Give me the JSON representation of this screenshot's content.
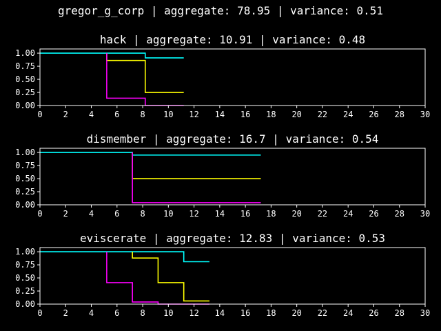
{
  "suptitle": "gregor_g_corp | aggregate: 78.95 | variance: 0.51",
  "chart_data": [
    {
      "type": "line",
      "title": "hack | aggregate: 10.91 | variance: 0.48",
      "xlim": [
        0,
        30
      ],
      "ylim": [
        0,
        1.08
      ],
      "xticks": [
        "0",
        "2",
        "4",
        "6",
        "8",
        "10",
        "12",
        "14",
        "16",
        "18",
        "20",
        "22",
        "24",
        "26",
        "28",
        "30"
      ],
      "yticks": [
        "0.00",
        "0.25",
        "0.50",
        "0.75",
        "1.00"
      ],
      "series": [
        {
          "color": "#00ffff",
          "x": [
            0,
            8.2,
            8.2,
            11.2
          ],
          "y": [
            1.0,
            1.0,
            0.91,
            0.91
          ]
        },
        {
          "color": "#ffff00",
          "x": [
            5.2,
            5.2,
            8.2,
            8.2,
            11.2
          ],
          "y": [
            1.0,
            0.86,
            0.86,
            0.25,
            0.25
          ]
        },
        {
          "color": "#ff00ff",
          "x": [
            5.2,
            5.2,
            8.2,
            8.2,
            11.2
          ],
          "y": [
            1.0,
            0.14,
            0.14,
            0.0,
            0.0
          ]
        }
      ]
    },
    {
      "type": "line",
      "title": "dismember | aggregate: 16.7 | variance: 0.54",
      "xlim": [
        0,
        30
      ],
      "ylim": [
        0,
        1.08
      ],
      "xticks": [
        "0",
        "2",
        "4",
        "6",
        "8",
        "10",
        "12",
        "14",
        "16",
        "18",
        "20",
        "22",
        "24",
        "26",
        "28",
        "30"
      ],
      "yticks": [
        "0.00",
        "0.25",
        "0.50",
        "0.75",
        "1.00"
      ],
      "series": [
        {
          "color": "#00ffff",
          "x": [
            0,
            7.2,
            7.2,
            17.2
          ],
          "y": [
            1.0,
            1.0,
            0.95,
            0.95
          ]
        },
        {
          "color": "#ffff00",
          "x": [
            7.2,
            7.2,
            17.2
          ],
          "y": [
            1.0,
            0.5,
            0.5
          ]
        },
        {
          "color": "#ff00ff",
          "x": [
            7.2,
            7.2,
            17.2
          ],
          "y": [
            1.0,
            0.04,
            0.04
          ]
        }
      ]
    },
    {
      "type": "line",
      "title": "eviscerate | aggregate: 12.83 | variance: 0.53",
      "xlim": [
        0,
        30
      ],
      "ylim": [
        0,
        1.08
      ],
      "xticks": [
        "0",
        "2",
        "4",
        "6",
        "8",
        "10",
        "12",
        "14",
        "16",
        "18",
        "20",
        "22",
        "24",
        "26",
        "28",
        "30"
      ],
      "yticks": [
        "0.00",
        "0.25",
        "0.50",
        "0.75",
        "1.00"
      ],
      "series": [
        {
          "color": "#00ffff",
          "x": [
            0,
            11.2,
            11.2,
            13.2
          ],
          "y": [
            1.0,
            1.0,
            0.81,
            0.81
          ]
        },
        {
          "color": "#ffff00",
          "x": [
            7.2,
            7.2,
            9.2,
            9.2,
            11.2,
            11.2,
            13.2
          ],
          "y": [
            1.0,
            0.88,
            0.88,
            0.41,
            0.41,
            0.06,
            0.06
          ]
        },
        {
          "color": "#ff00ff",
          "x": [
            5.2,
            5.2,
            7.2,
            7.2,
            9.2,
            9.2,
            13.2
          ],
          "y": [
            1.0,
            0.41,
            0.41,
            0.04,
            0.04,
            0.0,
            0.0
          ]
        }
      ]
    }
  ]
}
